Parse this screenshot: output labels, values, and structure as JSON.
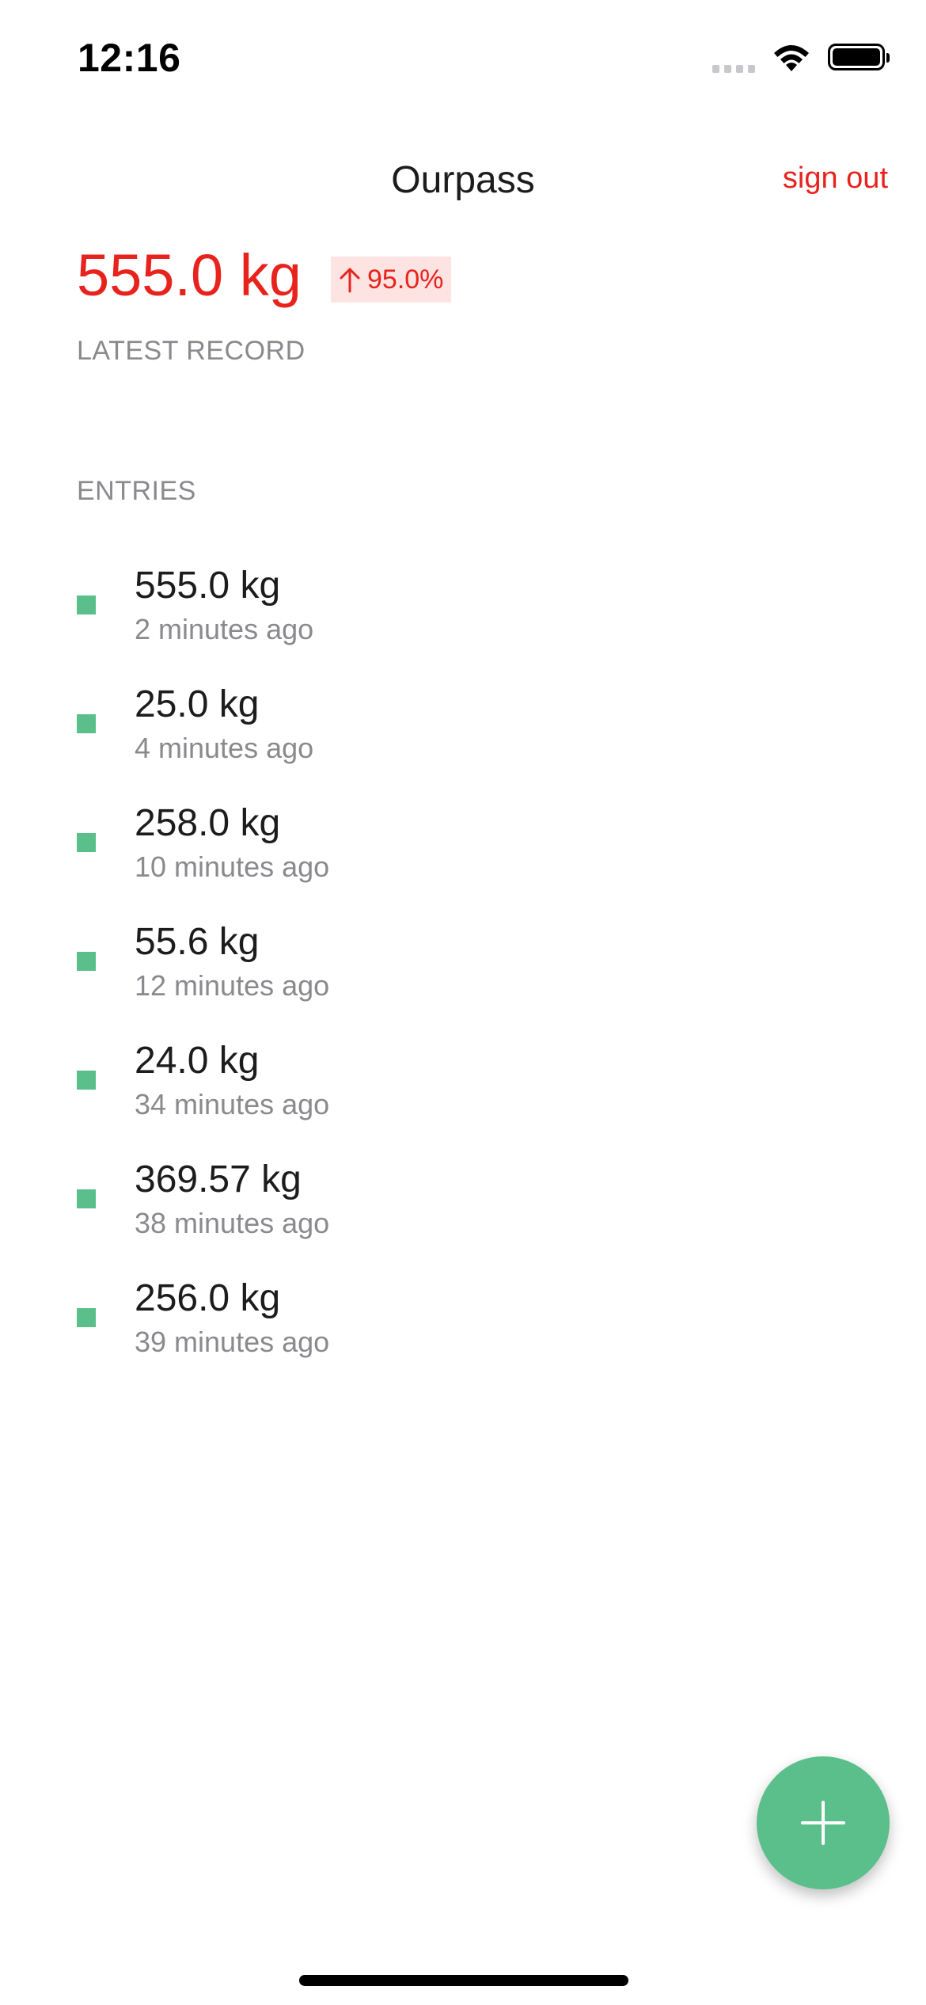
{
  "status_bar": {
    "time": "12:16"
  },
  "header": {
    "title": "Ourpass",
    "sign_out_label": "sign out"
  },
  "latest": {
    "value": "555.0 kg",
    "change": "95.0%",
    "change_direction": "up",
    "label": "LATEST RECORD"
  },
  "entries": {
    "label": "ENTRIES",
    "items": [
      {
        "value": "555.0 kg",
        "time": "2 minutes ago"
      },
      {
        "value": "25.0 kg",
        "time": "4 minutes ago"
      },
      {
        "value": "258.0 kg",
        "time": "10 minutes ago"
      },
      {
        "value": "55.6 kg",
        "time": "12 minutes ago"
      },
      {
        "value": "24.0 kg",
        "time": "34 minutes ago"
      },
      {
        "value": "369.57 kg",
        "time": "38 minutes ago"
      },
      {
        "value": "256.0 kg",
        "time": "39 minutes ago"
      }
    ]
  },
  "fab": {
    "icon": "plus-icon"
  },
  "colors": {
    "accent_red": "#e8231d",
    "badge_bg": "#fde3e1",
    "accent_green": "#5abf8a",
    "muted_text": "#8a8a8e"
  }
}
